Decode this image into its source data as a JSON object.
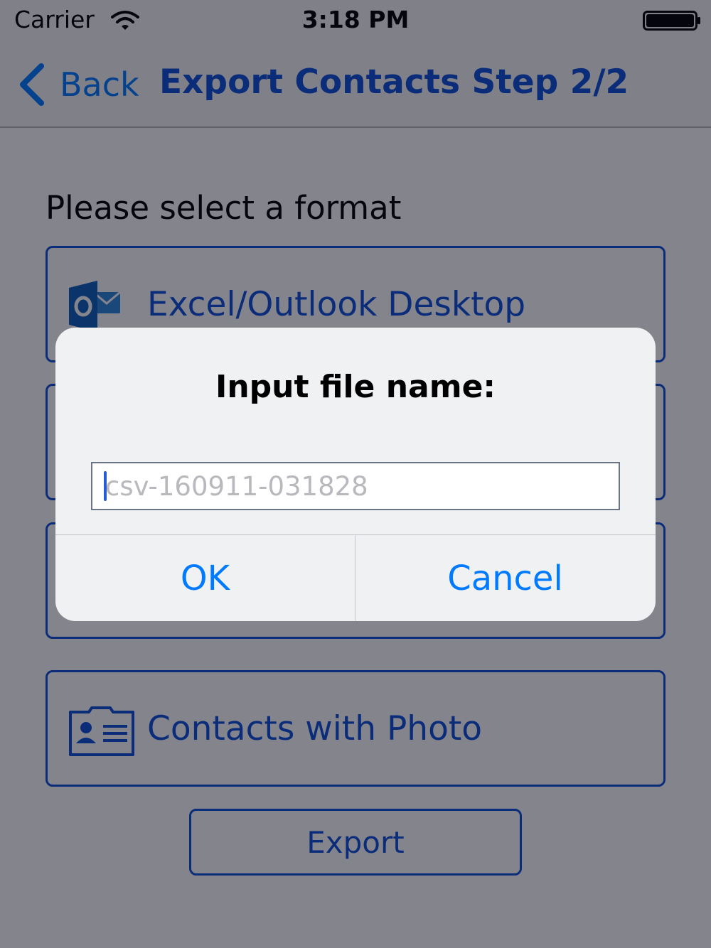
{
  "status_bar": {
    "carrier": "Carrier",
    "time": "3:18 PM",
    "wifi_icon": "wifi-icon",
    "battery_icon": "battery-full-icon"
  },
  "nav": {
    "back_label": "Back",
    "title": "Export Contacts Step 2/2"
  },
  "content": {
    "prompt": "Please select a format",
    "options": [
      {
        "label": "Excel/Outlook Desktop",
        "icon": "outlook-icon"
      },
      {
        "label": "",
        "icon": ""
      },
      {
        "label": "",
        "icon": ""
      },
      {
        "label": "Contacts with Photo",
        "icon": "contact-card-icon"
      }
    ],
    "export_label": "Export"
  },
  "alert": {
    "title": "Input file name:",
    "input_value": "",
    "input_placeholder": "csv-160911-031828",
    "ok_label": "OK",
    "cancel_label": "Cancel"
  },
  "colors": {
    "accent": "#0a4fd6",
    "system_blue": "#007aff",
    "outlook_blue": "#0a5eb8"
  }
}
